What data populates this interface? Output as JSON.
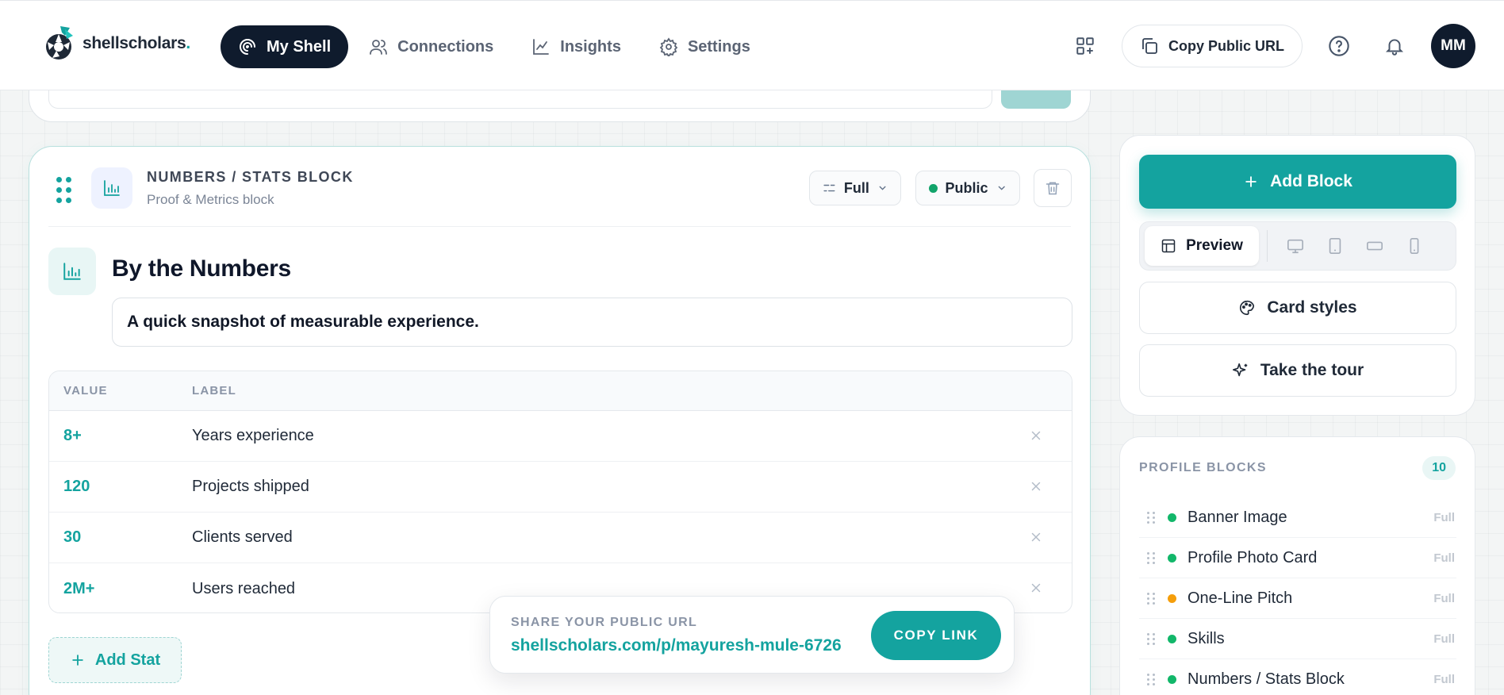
{
  "brand": {
    "name": "shellscholars",
    "dot": "."
  },
  "nav": {
    "items": [
      {
        "label": "My Shell",
        "active": true
      },
      {
        "label": "Connections",
        "active": false
      },
      {
        "label": "Insights",
        "active": false
      },
      {
        "label": "Settings",
        "active": false
      }
    ],
    "copy_public_url": "Copy Public URL",
    "avatar_initials": "MM"
  },
  "block": {
    "type_label": "NUMBERS / STATS BLOCK",
    "sub_label": "Proof & Metrics block",
    "width_option": "Full",
    "visibility_option": "Public",
    "title": "By the Numbers",
    "subtitle": "A quick snapshot of measurable experience.",
    "table": {
      "headers": {
        "value": "VALUE",
        "label": "LABEL"
      },
      "rows": [
        {
          "value": "8+",
          "label": "Years experience"
        },
        {
          "value": "120",
          "label": "Projects shipped"
        },
        {
          "value": "30",
          "label": "Clients served"
        },
        {
          "value": "2M+",
          "label": "Users reached"
        }
      ]
    },
    "add_stat_label": "Add Stat"
  },
  "share": {
    "label": "SHARE YOUR PUBLIC URL",
    "url": "shellscholars.com/p/mayuresh-mule-6726",
    "copy_label": "COPY LINK"
  },
  "sidebar": {
    "add_block_label": "Add Block",
    "preview_label": "Preview",
    "card_styles_label": "Card styles",
    "tour_label": "Take the tour",
    "profile_blocks": {
      "title": "PROFILE BLOCKS",
      "count": "10",
      "items": [
        {
          "name": "Banner Image",
          "width": "Full",
          "status_color": "#12b76a"
        },
        {
          "name": "Profile Photo Card",
          "width": "Full",
          "status_color": "#12b76a"
        },
        {
          "name": "One-Line Pitch",
          "width": "Full",
          "status_color": "#f59e0b"
        },
        {
          "name": "Skills",
          "width": "Full",
          "status_color": "#12b76a"
        },
        {
          "name": "Numbers / Stats Block",
          "width": "Full",
          "status_color": "#12b76a"
        }
      ]
    }
  },
  "colors": {
    "accent": "#14a39f",
    "dark": "#0f1b2d"
  }
}
